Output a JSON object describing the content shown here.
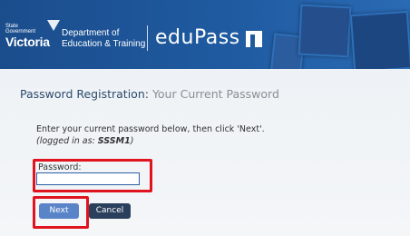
{
  "header": {
    "logo_state": "State\nGovernment",
    "logo_victoria": "Victoria",
    "department_line1": "Department of",
    "department_line2": "Education & Training",
    "product": "eduPass"
  },
  "page": {
    "title_main": "Password Registration:",
    "title_sub": "Your Current Password",
    "instruction": "Enter your current password below, then click 'Next'.",
    "logged_prefix": "(logged in as: ",
    "logged_user": "SSSM1",
    "logged_suffix": ")"
  },
  "form": {
    "password_label": "Password:",
    "password_value": ""
  },
  "buttons": {
    "next": "Next",
    "cancel": "Cancel"
  },
  "colors": {
    "header_blue": "#1f5aa0",
    "highlight_red": "#e0141e",
    "next_button": "#5a84c8",
    "cancel_button": "#2a3f5c"
  }
}
